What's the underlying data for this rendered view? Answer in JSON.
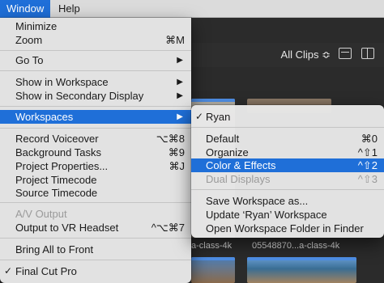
{
  "menubar": {
    "window": "Window",
    "help": "Help"
  },
  "browser": {
    "filter": "All Clips ≎",
    "clip_a_name": "a-class-4k",
    "clip_b_name": "05548870...a-class-4k"
  },
  "window_menu": {
    "minimize": "Minimize",
    "zoom": "Zoom",
    "zoom_shortcut": "⌘M",
    "go_to": "Go To",
    "show_in_workspace": "Show in Workspace",
    "show_in_secondary": "Show in Secondary Display",
    "workspaces": "Workspaces",
    "record_voiceover": "Record Voiceover",
    "record_voiceover_shortcut": "⌥⌘8",
    "background_tasks": "Background Tasks",
    "background_tasks_shortcut": "⌘9",
    "project_properties": "Project Properties...",
    "project_properties_shortcut": "⌘J",
    "project_timecode": "Project Timecode",
    "source_timecode": "Source Timecode",
    "av_output": "A/V Output",
    "output_vr": "Output to VR Headset",
    "output_vr_shortcut": "^⌥⌘7",
    "bring_all_to_front": "Bring All to Front",
    "final_cut_pro": "Final Cut Pro",
    "arrow": "▶",
    "check": "✓"
  },
  "workspaces_menu": {
    "ryan": "Ryan",
    "default": "Default",
    "default_shortcut": "⌘0",
    "organize": "Organize",
    "organize_shortcut": "^⇧1",
    "color_effects": "Color & Effects",
    "color_effects_shortcut": "^⇧2",
    "dual_displays": "Dual Displays",
    "dual_displays_shortcut": "^⇧3",
    "save_workspace_as": "Save Workspace as...",
    "update_ryan": "Update ‘Ryan’ Workspace",
    "open_folder": "Open Workspace Folder in Finder",
    "check": "✓"
  },
  "colors": {
    "selection": "#1f6fd8",
    "menu_bg": "#e8e8e8",
    "disabled_text": "#9a9a9a"
  }
}
